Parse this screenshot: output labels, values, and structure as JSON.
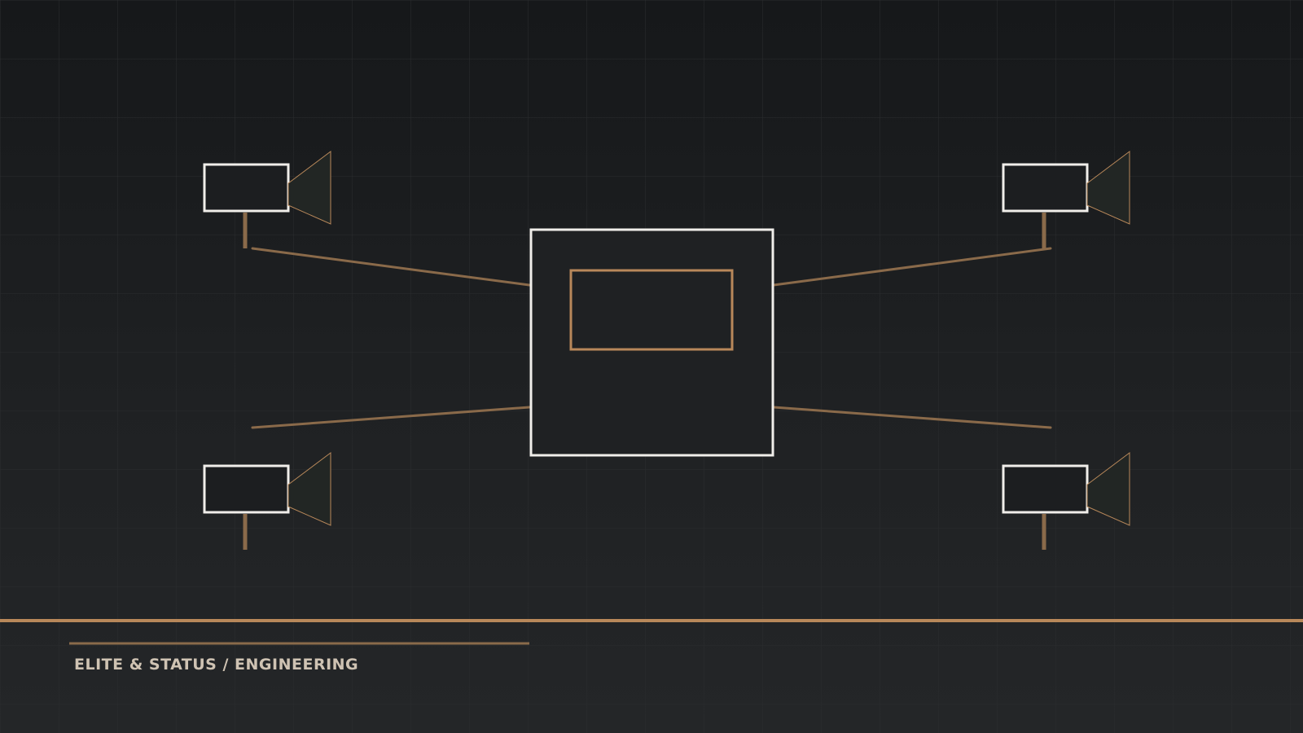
{
  "caption": "ELITE & STATUS / ENGINEERING",
  "colors": {
    "accent": "#b8885a",
    "accent_dim": "#8a6a4a",
    "outline": "#f0eeea",
    "grid": "#2c2e30",
    "caption_text": "#cfc3b3"
  },
  "icons": {
    "camera": "camera-icon",
    "hub": "central-hub-box"
  }
}
